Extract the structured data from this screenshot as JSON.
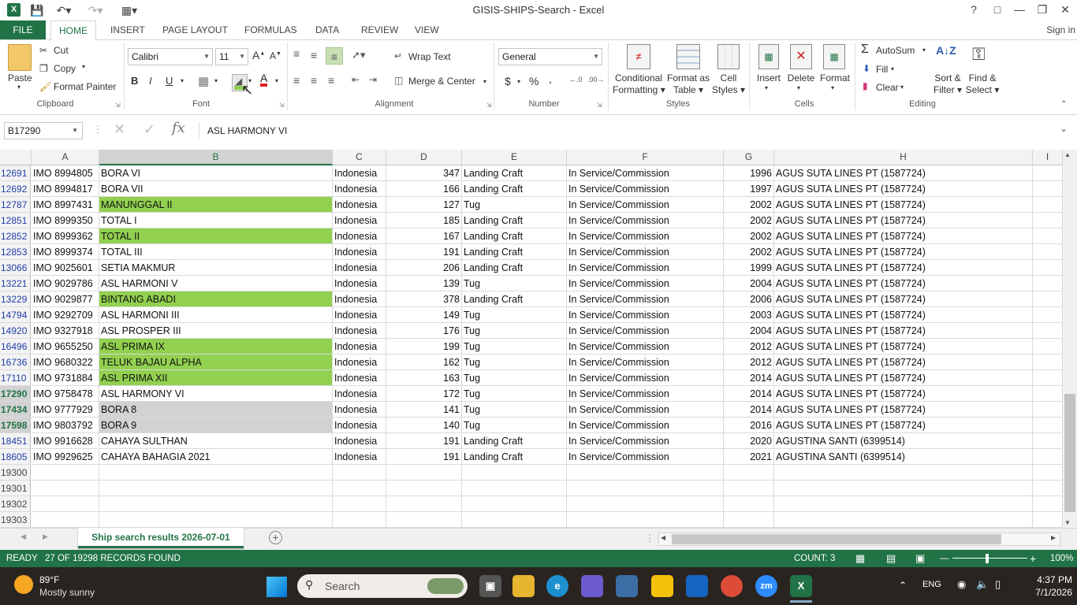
{
  "window": {
    "title": "GISIS-SHIPS-Search - Excel",
    "help": "?"
  },
  "ribbon_tabs": [
    "FILE",
    "HOME",
    "INSERT",
    "PAGE LAYOUT",
    "FORMULAS",
    "DATA",
    "REVIEW",
    "VIEW"
  ],
  "signin": "Sign in",
  "clipboard": {
    "paste": "Paste",
    "cut": "Cut",
    "copy": "Copy",
    "format_painter": "Format Painter",
    "label": "Clipboard"
  },
  "font": {
    "name": "Calibri",
    "size": "11",
    "label": "Font",
    "bold": "B",
    "italic": "I",
    "underline": "U"
  },
  "alignment": {
    "wrap": "Wrap Text",
    "merge": "Merge & Center",
    "label": "Alignment"
  },
  "number": {
    "format": "General",
    "currency": "$",
    "percent": "%",
    "comma": ",",
    "label": "Number"
  },
  "styles": {
    "conditional": "Conditional",
    "conditional2": "Formatting",
    "format_as": "Format as",
    "format_as2": "Table",
    "cell": "Cell",
    "cell2": "Styles",
    "label": "Styles"
  },
  "cells": {
    "insert": "Insert",
    "delete": "Delete",
    "format": "Format",
    "label": "Cells"
  },
  "editing": {
    "autosum": "AutoSum",
    "fill": "Fill",
    "clear": "Clear",
    "sort": "Sort &",
    "sort2": "Filter",
    "find": "Find &",
    "find2": "Select",
    "label": "Editing"
  },
  "formula_bar": {
    "name_box": "B17290",
    "formula": "ASL HARMONY VI",
    "fx": "fx"
  },
  "columns": [
    "A",
    "B",
    "C",
    "D",
    "E",
    "F",
    "G",
    "H",
    "I"
  ],
  "rows": [
    {
      "n": "12691",
      "a": "IMO 8994805",
      "b": "BORA VI",
      "c": "Indonesia",
      "d": "347",
      "e": "Landing Craft",
      "f": "In Service/Commission",
      "g": "1996",
      "h": "AGUS SUTA LINES PT (1587724)",
      "fill": ""
    },
    {
      "n": "12692",
      "a": "IMO 8994817",
      "b": "BORA VII",
      "c": "Indonesia",
      "d": "166",
      "e": "Landing Craft",
      "f": "In Service/Commission",
      "g": "1997",
      "h": "AGUS SUTA LINES PT (1587724)",
      "fill": ""
    },
    {
      "n": "12787",
      "a": "IMO 8997431",
      "b": "MANUNGGAL II",
      "c": "Indonesia",
      "d": "127",
      "e": "Tug",
      "f": "In Service/Commission",
      "g": "2002",
      "h": "AGUS SUTA LINES PT (1587724)",
      "fill": "green"
    },
    {
      "n": "12851",
      "a": "IMO 8999350",
      "b": "TOTAL I",
      "c": "Indonesia",
      "d": "185",
      "e": "Landing Craft",
      "f": "In Service/Commission",
      "g": "2002",
      "h": "AGUS SUTA LINES PT (1587724)",
      "fill": ""
    },
    {
      "n": "12852",
      "a": "IMO 8999362",
      "b": "TOTAL II",
      "c": "Indonesia",
      "d": "167",
      "e": "Landing Craft",
      "f": "In Service/Commission",
      "g": "2002",
      "h": "AGUS SUTA LINES PT (1587724)",
      "fill": "green"
    },
    {
      "n": "12853",
      "a": "IMO 8999374",
      "b": "TOTAL III",
      "c": "Indonesia",
      "d": "191",
      "e": "Landing Craft",
      "f": "In Service/Commission",
      "g": "2002",
      "h": "AGUS SUTA LINES PT (1587724)",
      "fill": ""
    },
    {
      "n": "13066",
      "a": "IMO 9025601",
      "b": "SETIA MAKMUR",
      "c": "Indonesia",
      "d": "206",
      "e": "Landing Craft",
      "f": "In Service/Commission",
      "g": "1999",
      "h": "AGUS SUTA LINES PT (1587724)",
      "fill": ""
    },
    {
      "n": "13221",
      "a": "IMO 9029786",
      "b": "ASL HARMONI V",
      "c": "Indonesia",
      "d": "139",
      "e": "Tug",
      "f": "In Service/Commission",
      "g": "2004",
      "h": "AGUS SUTA LINES PT (1587724)",
      "fill": ""
    },
    {
      "n": "13229",
      "a": "IMO 9029877",
      "b": "BINTANG ABADI",
      "c": "Indonesia",
      "d": "378",
      "e": "Landing Craft",
      "f": "In Service/Commission",
      "g": "2006",
      "h": "AGUS SUTA LINES PT (1587724)",
      "fill": "green"
    },
    {
      "n": "14794",
      "a": "IMO 9292709",
      "b": "ASL HARMONI III",
      "c": "Indonesia",
      "d": "149",
      "e": "Tug",
      "f": "In Service/Commission",
      "g": "2003",
      "h": "AGUS SUTA LINES PT (1587724)",
      "fill": ""
    },
    {
      "n": "14920",
      "a": "IMO 9327918",
      "b": "ASL PROSPER III",
      "c": "Indonesia",
      "d": "176",
      "e": "Tug",
      "f": "In Service/Commission",
      "g": "2004",
      "h": "AGUS SUTA LINES PT (1587724)",
      "fill": ""
    },
    {
      "n": "16496",
      "a": "IMO 9655250",
      "b": "ASL PRIMA IX",
      "c": "Indonesia",
      "d": "199",
      "e": "Tug",
      "f": "In Service/Commission",
      "g": "2012",
      "h": "AGUS SUTA LINES PT (1587724)",
      "fill": "green"
    },
    {
      "n": "16736",
      "a": "IMO 9680322",
      "b": "TELUK BAJAU ALPHA",
      "c": "Indonesia",
      "d": "162",
      "e": "Tug",
      "f": "In Service/Commission",
      "g": "2012",
      "h": "AGUS SUTA LINES PT (1587724)",
      "fill": "green"
    },
    {
      "n": "17110",
      "a": "IMO 9731884",
      "b": "ASL PRIMA XII",
      "c": "Indonesia",
      "d": "163",
      "e": "Tug",
      "f": "In Service/Commission",
      "g": "2014",
      "h": "AGUS SUTA LINES PT (1587724)",
      "fill": "green"
    },
    {
      "n": "17290",
      "a": "IMO 9758478",
      "b": "ASL HARMONY VI",
      "c": "Indonesia",
      "d": "172",
      "e": "Tug",
      "f": "In Service/Commission",
      "g": "2014",
      "h": "AGUS SUTA LINES PT (1587724)",
      "fill": "active"
    },
    {
      "n": "17434",
      "a": "IMO 9777929",
      "b": "BORA 8",
      "c": "Indonesia",
      "d": "141",
      "e": "Tug",
      "f": "In Service/Commission",
      "g": "2014",
      "h": "AGUS SUTA LINES PT (1587724)",
      "fill": "gray"
    },
    {
      "n": "17598",
      "a": "IMO 9803792",
      "b": "BORA 9",
      "c": "Indonesia",
      "d": "140",
      "e": "Tug",
      "f": "In Service/Commission",
      "g": "2016",
      "h": "AGUS SUTA LINES PT (1587724)",
      "fill": "gray"
    },
    {
      "n": "18451",
      "a": "IMO 9916628",
      "b": "CAHAYA SULTHAN",
      "c": "Indonesia",
      "d": "191",
      "e": "Landing Craft",
      "f": "In Service/Commission",
      "g": "2020",
      "h": "AGUSTINA SANTI (6399514)",
      "fill": ""
    },
    {
      "n": "18605",
      "a": "IMO 9929625",
      "b": "CAHAYA BAHAGIA 2021",
      "c": "Indonesia",
      "d": "191",
      "e": "Landing Craft",
      "f": "In Service/Commission",
      "g": "2021",
      "h": "AGUSTINA SANTI (6399514)",
      "fill": ""
    },
    {
      "n": "19300",
      "a": "",
      "b": "",
      "c": "",
      "d": "",
      "e": "",
      "f": "",
      "g": "",
      "h": "",
      "fill": ""
    },
    {
      "n": "19301",
      "a": "",
      "b": "",
      "c": "",
      "d": "",
      "e": "",
      "f": "",
      "g": "",
      "h": "",
      "fill": ""
    },
    {
      "n": "19302",
      "a": "",
      "b": "",
      "c": "",
      "d": "",
      "e": "",
      "f": "",
      "g": "",
      "h": "",
      "fill": ""
    },
    {
      "n": "19303",
      "a": "",
      "b": "",
      "c": "",
      "d": "",
      "e": "",
      "f": "",
      "g": "",
      "h": "",
      "fill": ""
    }
  ],
  "colors": {
    "excel_green": "#217346",
    "highlight_green": "#92d050",
    "selection_gray": "#d2d2d2"
  },
  "sheet_tab": "Ship search results 2026-07-01",
  "status": {
    "mode": "READY",
    "records": "27 OF 19298 RECORDS FOUND",
    "count": "COUNT: 3",
    "zoom": "100%"
  },
  "taskbar": {
    "temp": "89°F",
    "weather": "Mostly sunny",
    "search": "Search",
    "lang": "ENG",
    "time": "4:37 PM",
    "date": "7/1/2026"
  }
}
